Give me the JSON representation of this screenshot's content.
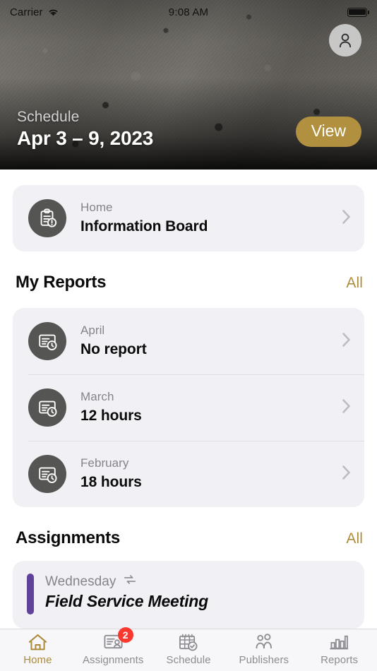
{
  "status_bar": {
    "carrier": "Carrier",
    "time": "9:08 AM",
    "wifi_icon": "wifi-icon",
    "battery_icon": "battery-full-icon"
  },
  "hero": {
    "kicker": "Schedule",
    "title": "Apr 3 – 9, 2023",
    "view_button": "View",
    "avatar_icon": "person-icon",
    "accent_color": "#b1913f"
  },
  "info_board": {
    "sub": "Home",
    "title": "Information Board",
    "icon": "clipboard-alert-icon",
    "chevron_icon": "chevron-right-icon"
  },
  "reports": {
    "section_title": "My Reports",
    "all_label": "All",
    "items": [
      {
        "month": "April",
        "value": "No report",
        "icon": "report-clock-icon"
      },
      {
        "month": "March",
        "value": "12 hours",
        "icon": "report-clock-icon"
      },
      {
        "month": "February",
        "value": "18 hours",
        "icon": "report-clock-icon"
      }
    ]
  },
  "assignments": {
    "section_title": "Assignments",
    "all_label": "All",
    "accent_color": "#61429b",
    "items": [
      {
        "day": "Wednesday",
        "title": "Field Service Meeting",
        "repeat_icon": "repeat-icon"
      }
    ]
  },
  "tabbar": {
    "items": [
      {
        "label": "Home",
        "icon": "home-icon",
        "active": true,
        "badge": ""
      },
      {
        "label": "Assignments",
        "icon": "assignments-icon",
        "active": false,
        "badge": "2"
      },
      {
        "label": "Schedule",
        "icon": "calendar-check-icon",
        "active": false,
        "badge": ""
      },
      {
        "label": "Publishers",
        "icon": "people-icon",
        "active": false,
        "badge": ""
      },
      {
        "label": "Reports",
        "icon": "bar-chart-icon",
        "active": false,
        "badge": ""
      }
    ],
    "active_color": "#ab8a3a",
    "inactive_color": "#8c8c92",
    "badge_color": "#f9392f"
  }
}
